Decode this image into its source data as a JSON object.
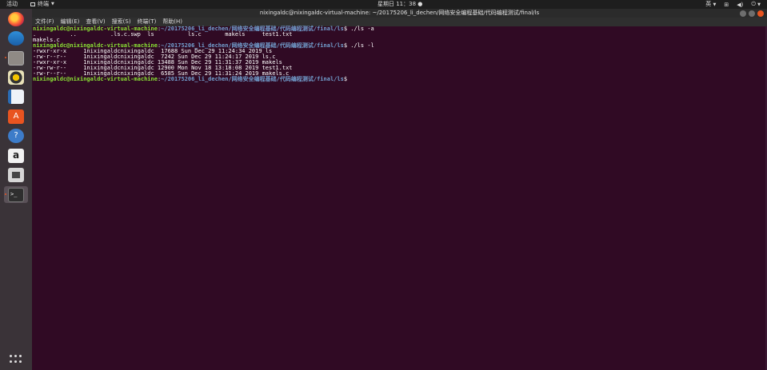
{
  "top_panel": {
    "activities": "活动",
    "app_menu": "终端",
    "clock": "星期日 11：38",
    "lang": "英"
  },
  "window": {
    "title": "nixingaldc@nixingaldc-virtual-machine: ~/20175206_li_dechen/网络安全编程基础/代码编程测试/final/ls",
    "menu": [
      "文件(F)",
      "编辑(E)",
      "查看(V)",
      "搜索(S)",
      "终端(T)",
      "帮助(H)"
    ]
  },
  "terminal": {
    "prompt_user": "nixingaldc@nixingaldc-virtual-machine",
    "prompt_path": "~/20175206_li_dechen/网络安全编程基础/代码编程测试/final/ls",
    "cmd1": " ./ls -a",
    "out1": ".          ..          .ls.c.swp  ls          ls.c       makels     test1.txt",
    "out2": "makels.c",
    "cmd2": " ./ls -l",
    "ls_l": [
      "-rwxr-xr-x     1nixingaldcnixingaldc  17688 Sun Dec 29 11:24:34 2019 ls",
      "-rw-r--r--     1nixingaldcnixingaldc  7242 Sun Dec 29 11:24:17 2019 ls.c",
      "-rwxr-xr-x     1nixingaldcnixingaldc 13488 Sun Dec 29 11:31:37 2019 makels",
      "-rw-rw-r--     1nixingaldcnixingaldc 12900 Mon Nov 18 13:18:08 2019 test1.txt",
      "-rw-r--r--     1nixingaldcnixingaldc  6585 Sun Dec 29 11:31:24 2019 makels.c"
    ]
  },
  "dock": {
    "icons": [
      "firefox-icon",
      "thunderbird-icon",
      "files-icon",
      "rhythmbox-icon",
      "libreoffice-writer-icon",
      "software-center-icon",
      "help-icon",
      "amazon-icon",
      "screenshot-icon",
      "terminal-icon",
      "show-applications-icon"
    ]
  },
  "colors": {
    "terminal_bg": "#300a24",
    "prompt_user": "#8ae234",
    "prompt_path": "#729fcf",
    "accent": "#e95420"
  }
}
